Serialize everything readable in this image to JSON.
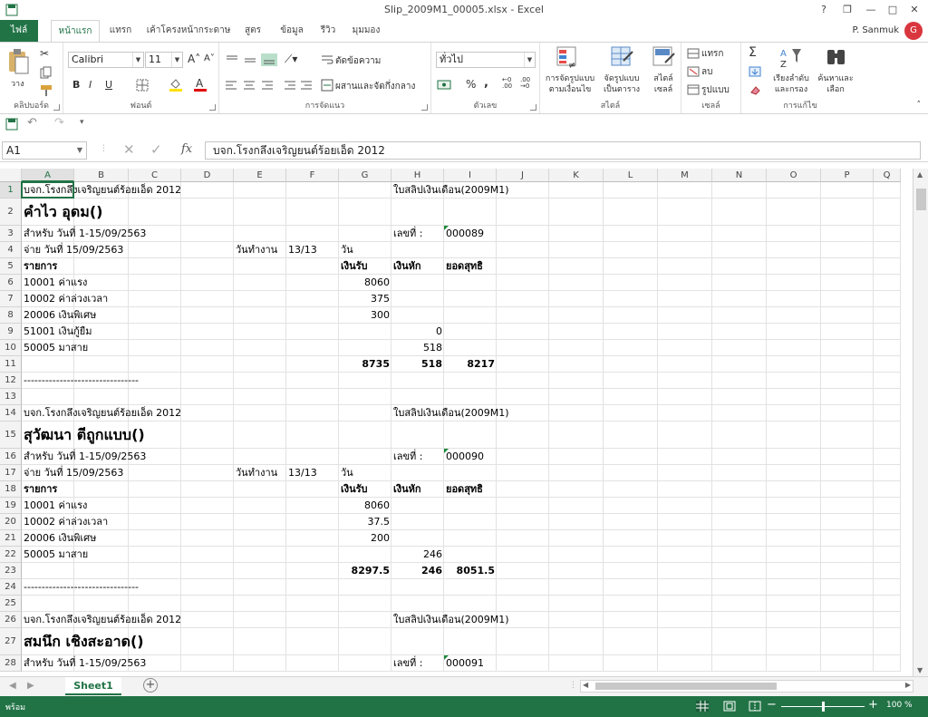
{
  "window": {
    "title": "Slip_2009M1_00005.xlsx - Excel",
    "help": "?",
    "restore": "❐",
    "minimize": "—",
    "maximize": "□",
    "close": "✕"
  },
  "tabs": [
    "ไฟล์",
    "หน้าแรก",
    "แทรก",
    "เค้าโครงหน้ากระดาษ",
    "สูตร",
    "ข้อมูล",
    "รีวิว",
    "มุมมอง"
  ],
  "user": {
    "name": "P. Sanmuk",
    "avatar": "G"
  },
  "ribbon": {
    "clipboard": {
      "label": "คลิปบอร์ด",
      "paste": "วาง"
    },
    "font": {
      "label": "ฟอนต์",
      "name": "Calibri",
      "size": "11",
      "bold": "B",
      "italic": "I",
      "underline": "U"
    },
    "alignment": {
      "label": "การจัดแนว",
      "wrap": "ตัดข้อความ",
      "merge": "ผสานและจัดกึ่งกลาง"
    },
    "number": {
      "label": "ตัวเลข",
      "format": "ทั่วไป",
      "percent": "%",
      "comma": ","
    },
    "styles": {
      "label": "สไตล์",
      "conditional": [
        "การจัดรูปแบบ",
        "ตามเงื่อนไข"
      ],
      "format_table": [
        "จัดรูปแบบ",
        "เป็นตาราง"
      ],
      "cell_styles": [
        "สไตล์",
        "เซลล์"
      ]
    },
    "cells": {
      "label": "เซลล์",
      "insert": "แทรก",
      "delete": "ลบ",
      "format": "รูปแบบ"
    },
    "editing": {
      "label": "การแก้ไข",
      "sigma": "Σ",
      "sort": [
        "เรียงลำดับ",
        "และกรอง"
      ],
      "find": [
        "ค้นหาและ",
        "เลือก"
      ]
    }
  },
  "formula_bar": {
    "name_box": "A1",
    "fx": "fx",
    "value": "บจก.โรงกลึงเจริญยนต์ร้อยเอ็ด 2012"
  },
  "columns": [
    "A",
    "B",
    "C",
    "D",
    "E",
    "F",
    "G",
    "H",
    "I",
    "J",
    "K",
    "L",
    "M",
    "N",
    "O",
    "P",
    "Q"
  ],
  "rows": [
    "1",
    "2",
    "3",
    "4",
    "5",
    "6",
    "7",
    "8",
    "9",
    "10",
    "11",
    "12",
    "13",
    "14",
    "15",
    "16",
    "17",
    "18",
    "19",
    "20",
    "21",
    "22",
    "23",
    "24",
    "25",
    "26",
    "27",
    "28"
  ],
  "cells": [
    {
      "r": 1,
      "c": "A",
      "v": "บจก.โรงกลึงเจริญยนต์ร้อยเอ็ด 2012"
    },
    {
      "r": 1,
      "c": "H",
      "v": "ใบสลิปเงินเดือน(2009M1)"
    },
    {
      "r": 2,
      "c": "A",
      "v": "คำไว อุดม()",
      "s": "big"
    },
    {
      "r": 3,
      "c": "A",
      "v": "สำหรับ วันที่ 1-15/09/2563"
    },
    {
      "r": 3,
      "c": "H",
      "v": "เลขที่ :"
    },
    {
      "r": 3,
      "c": "I",
      "v": "000089",
      "tri": true
    },
    {
      "r": 4,
      "c": "A",
      "v": "จ่าย วันที่ 15/09/2563"
    },
    {
      "r": 4,
      "c": "E",
      "v": "วันทำงาน"
    },
    {
      "r": 4,
      "c": "F",
      "v": "13/13"
    },
    {
      "r": 4,
      "c": "G",
      "v": "วัน"
    },
    {
      "r": 5,
      "c": "A",
      "v": "รายการ",
      "s": "hdr"
    },
    {
      "r": 5,
      "c": "G",
      "v": "เงินรับ",
      "s": "hdr"
    },
    {
      "r": 5,
      "c": "H",
      "v": "เงินหัก",
      "s": "hdr"
    },
    {
      "r": 5,
      "c": "I",
      "v": "ยอดสุทธิ",
      "s": "hdr"
    },
    {
      "r": 6,
      "c": "A",
      "v": "10001 ค่าแรง"
    },
    {
      "r": 6,
      "c": "G",
      "v": "8060",
      "s": "num"
    },
    {
      "r": 7,
      "c": "A",
      "v": "10002 ค่าล่วงเวลา"
    },
    {
      "r": 7,
      "c": "G",
      "v": "375",
      "s": "num"
    },
    {
      "r": 8,
      "c": "A",
      "v": "20006 เงินพิเศษ"
    },
    {
      "r": 8,
      "c": "G",
      "v": "300",
      "s": "num"
    },
    {
      "r": 9,
      "c": "A",
      "v": "51001 เงินกู้ยืม"
    },
    {
      "r": 9,
      "c": "H",
      "v": "0",
      "s": "num"
    },
    {
      "r": 10,
      "c": "A",
      "v": "50005 มาสาย"
    },
    {
      "r": 10,
      "c": "H",
      "v": "518",
      "s": "num"
    },
    {
      "r": 11,
      "c": "G",
      "v": "8735",
      "s": "numb"
    },
    {
      "r": 11,
      "c": "H",
      "v": "518",
      "s": "numb"
    },
    {
      "r": 11,
      "c": "I",
      "v": "8217",
      "s": "numb"
    },
    {
      "r": 12,
      "c": "A",
      "v": "--------------------------------"
    },
    {
      "r": 14,
      "c": "A",
      "v": "บจก.โรงกลึงเจริญยนต์ร้อยเอ็ด 2012"
    },
    {
      "r": 14,
      "c": "H",
      "v": "ใบสลิปเงินเดือน(2009M1)"
    },
    {
      "r": 15,
      "c": "A",
      "v": "สุวัฒนา    ตีถูกแบบ()",
      "s": "big"
    },
    {
      "r": 16,
      "c": "A",
      "v": "สำหรับ วันที่ 1-15/09/2563"
    },
    {
      "r": 16,
      "c": "H",
      "v": "เลขที่ :"
    },
    {
      "r": 16,
      "c": "I",
      "v": "000090",
      "tri": true
    },
    {
      "r": 17,
      "c": "A",
      "v": "จ่าย วันที่ 15/09/2563"
    },
    {
      "r": 17,
      "c": "E",
      "v": "วันทำงาน"
    },
    {
      "r": 17,
      "c": "F",
      "v": "13/13"
    },
    {
      "r": 17,
      "c": "G",
      "v": "วัน"
    },
    {
      "r": 18,
      "c": "A",
      "v": "รายการ",
      "s": "hdr"
    },
    {
      "r": 18,
      "c": "G",
      "v": "เงินรับ",
      "s": "hdr"
    },
    {
      "r": 18,
      "c": "H",
      "v": "เงินหัก",
      "s": "hdr"
    },
    {
      "r": 18,
      "c": "I",
      "v": "ยอดสุทธิ",
      "s": "hdr"
    },
    {
      "r": 19,
      "c": "A",
      "v": "10001 ค่าแรง"
    },
    {
      "r": 19,
      "c": "G",
      "v": "8060",
      "s": "num"
    },
    {
      "r": 20,
      "c": "A",
      "v": "10002 ค่าล่วงเวลา"
    },
    {
      "r": 20,
      "c": "G",
      "v": "37.5",
      "s": "num"
    },
    {
      "r": 21,
      "c": "A",
      "v": "20006 เงินพิเศษ"
    },
    {
      "r": 21,
      "c": "G",
      "v": "200",
      "s": "num"
    },
    {
      "r": 22,
      "c": "A",
      "v": "50005 มาสาย"
    },
    {
      "r": 22,
      "c": "H",
      "v": "246",
      "s": "num"
    },
    {
      "r": 23,
      "c": "G",
      "v": "8297.5",
      "s": "numb"
    },
    {
      "r": 23,
      "c": "H",
      "v": "246",
      "s": "numb"
    },
    {
      "r": 23,
      "c": "I",
      "v": "8051.5",
      "s": "numb"
    },
    {
      "r": 24,
      "c": "A",
      "v": "--------------------------------"
    },
    {
      "r": 26,
      "c": "A",
      "v": "บจก.โรงกลึงเจริญยนต์ร้อยเอ็ด 2012"
    },
    {
      "r": 26,
      "c": "H",
      "v": "ใบสลิปเงินเดือน(2009M1)"
    },
    {
      "r": 27,
      "c": "A",
      "v": "สมนึก เชิงสะอาด()",
      "s": "big"
    },
    {
      "r": 28,
      "c": "A",
      "v": "สำหรับ วันที่ 1-15/09/2563"
    },
    {
      "r": 28,
      "c": "H",
      "v": "เลขที่ :"
    },
    {
      "r": 28,
      "c": "I",
      "v": "000091",
      "tri": true
    }
  ],
  "sheet_tabs": [
    "Sheet1"
  ],
  "status": {
    "ready": "พร้อม",
    "zoom": "100 %",
    "zoom_level": 1.0
  },
  "colors": {
    "accent": "#217346",
    "file_tab": "#217346",
    "avatar": "#d9363e"
  }
}
